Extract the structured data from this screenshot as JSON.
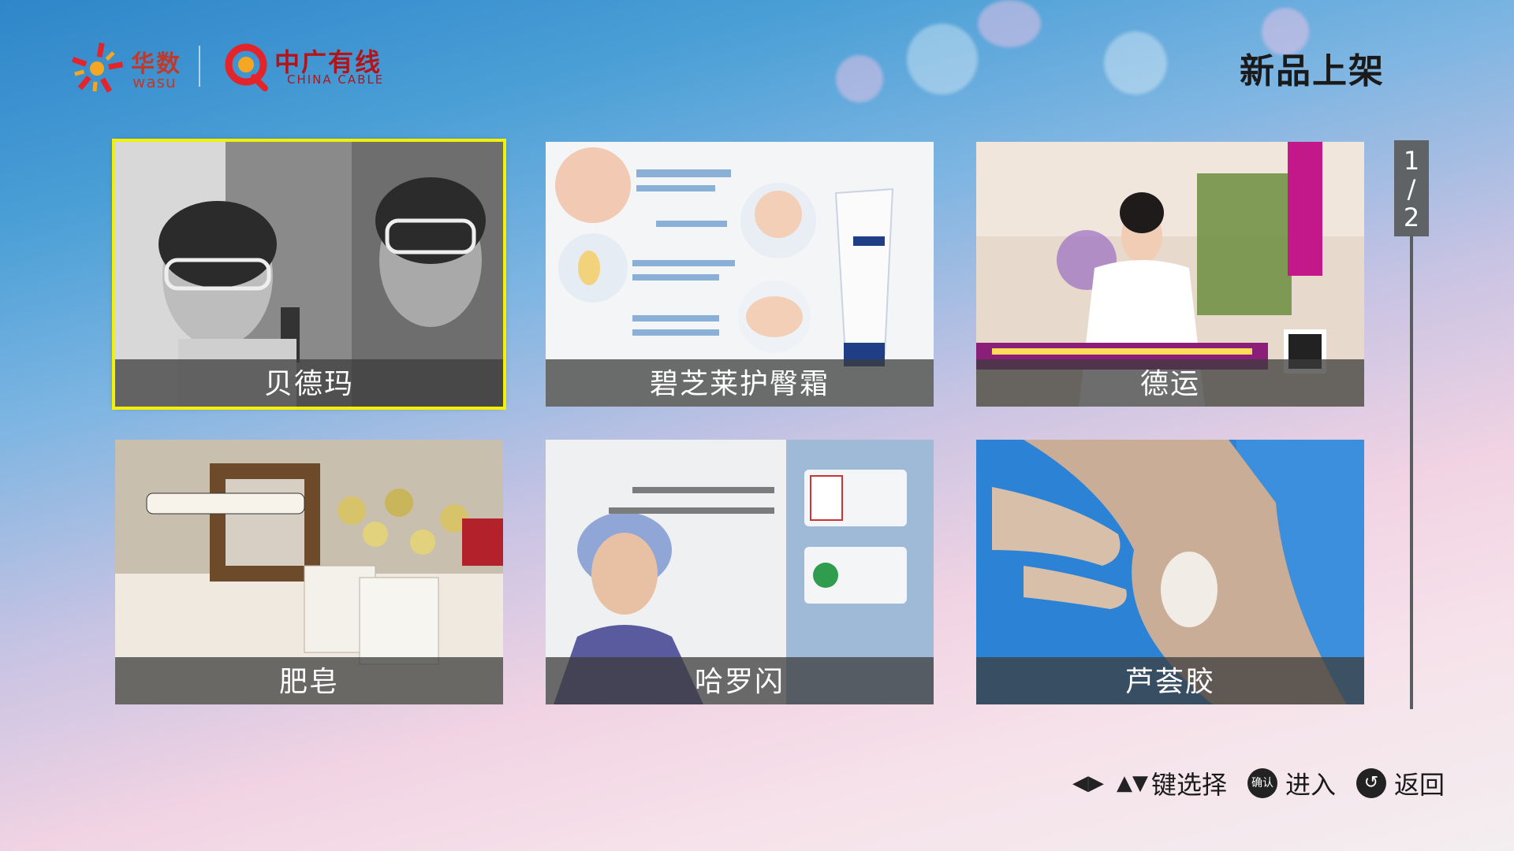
{
  "header": {
    "logo_wasu_cn": "华数",
    "logo_wasu_en": "wasu",
    "logo_china_cn": "中广有线",
    "logo_china_en": "CHINA CABLE",
    "page_title": "新品上架"
  },
  "tiles": [
    {
      "label": "贝德玛",
      "focused": true
    },
    {
      "label": "碧芝莱护臀霜",
      "focused": false
    },
    {
      "label": "德运",
      "focused": false
    },
    {
      "label": "肥皂",
      "focused": false
    },
    {
      "label": "哈罗闪",
      "focused": false
    },
    {
      "label": "芦荟胶",
      "focused": false
    }
  ],
  "pager": {
    "current": "1",
    "sep": "/",
    "total": "2"
  },
  "hints": {
    "select_label": "键选择",
    "confirm_icon": "确认",
    "enter_label": "进入",
    "back_label": "返回"
  },
  "colors": {
    "focus": "#f5f000",
    "caption_bg": "#3c3c3c"
  }
}
